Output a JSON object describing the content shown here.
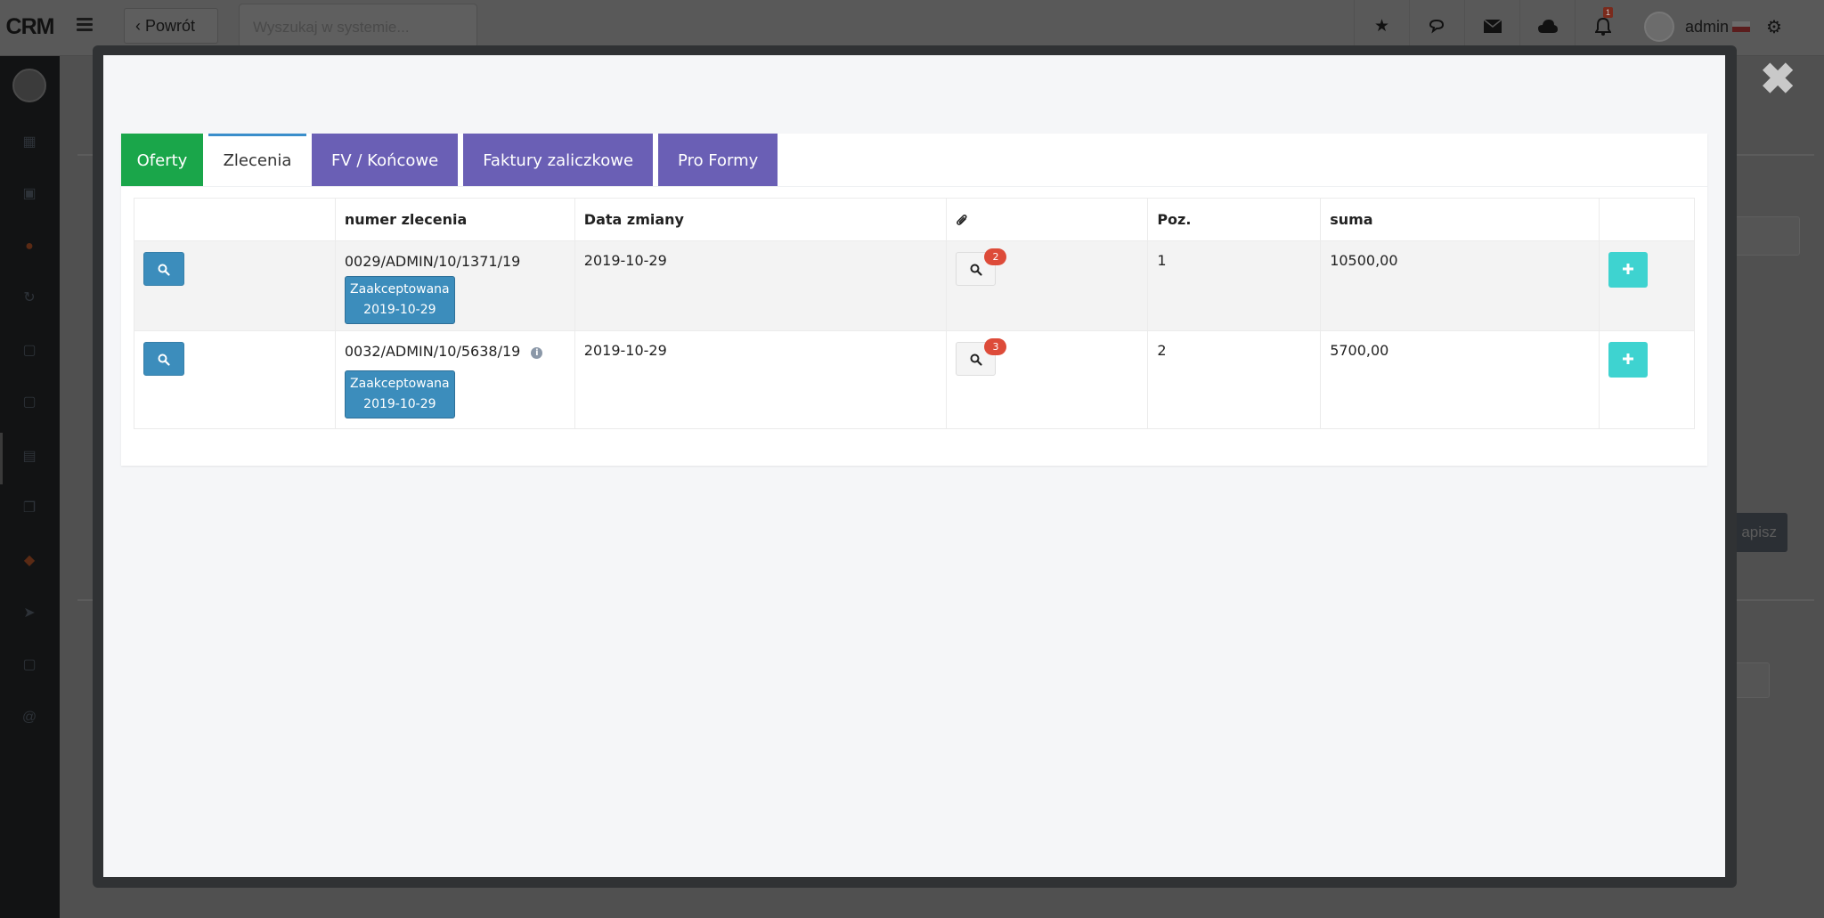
{
  "app": {
    "logo": "CRM",
    "back_label": "Powrót",
    "search_placeholder": "Wyszukaj w systemie...",
    "user_name": "admin",
    "notifications_count": "1",
    "bg_button_label": "apisz"
  },
  "modal": {
    "close_label": "✖",
    "tabs": [
      {
        "label": "Oferty",
        "color": "#1aa64a"
      },
      {
        "label": "Zlecenia",
        "active": true
      },
      {
        "label": "FV / Końcowe",
        "color": "#6a5fb5"
      },
      {
        "label": "Faktury zaliczkowe",
        "color": "#6a5fb5"
      },
      {
        "label": "Pro Formy",
        "color": "#6a5fb5"
      }
    ],
    "table": {
      "headers": [
        "",
        "numer zlecenia",
        "Data zmiany",
        "paperclip-icon",
        "Poz.",
        "suma",
        ""
      ],
      "rows": [
        {
          "number": "0029/ADMIN/10/1371/19",
          "status": "Zaakceptowana",
          "status_date": "2019-10-29",
          "date": "2019-10-29",
          "attachments": "2",
          "positions": "1",
          "sum": "10500,00"
        },
        {
          "number": "0032/ADMIN/10/5638/19",
          "status": "Zaakceptowana",
          "status_date": "2019-10-29",
          "date": "2019-10-29",
          "attachments": "3",
          "positions": "2",
          "sum": "5700,00",
          "info": "i"
        }
      ]
    }
  },
  "colors": {
    "primary_blue": "#3c8dbc",
    "teal": "#3ed3d0",
    "badge_red": "#dd4b39",
    "green_tab": "#1aa64a",
    "purple_tab": "#6a5fb5"
  }
}
